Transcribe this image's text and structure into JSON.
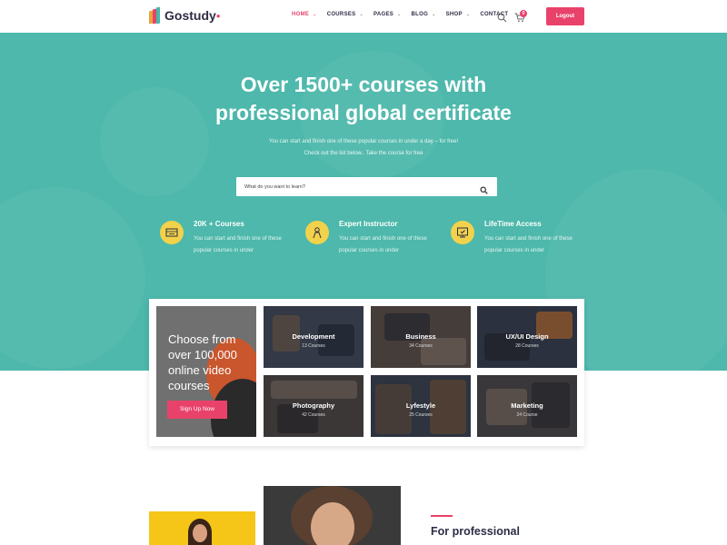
{
  "brand": {
    "name": "Gostudy",
    "colors": {
      "primary": "#e9426a",
      "hero": "#4db8ab",
      "accent": "#f2d24b",
      "dark": "#2c2c45"
    }
  },
  "nav": {
    "items": [
      {
        "label": "HOME",
        "active": true,
        "has_caret": true
      },
      {
        "label": "COURSES",
        "active": false,
        "has_caret": true
      },
      {
        "label": "PAGES",
        "active": false,
        "has_caret": true
      },
      {
        "label": "BLOG",
        "active": false,
        "has_caret": true
      },
      {
        "label": "SHOP",
        "active": false,
        "has_caret": true
      },
      {
        "label": "CONTACT",
        "active": false,
        "has_caret": false
      }
    ],
    "cart_count": "0",
    "logout_label": "Logout",
    "icons": {
      "search": "search-icon",
      "cart": "cart-icon",
      "caret": "chevron-down-icon"
    }
  },
  "hero": {
    "title_line1_pre": "Over ",
    "title_line1_bold": "1500+",
    "title_line1_post": " courses with",
    "title_line2_bold": "professional",
    "title_line2_post": " global certificate",
    "subtitle_line1": "You can start and finish one of these popular courses in under a day – for free!",
    "subtitle_line2": "Check out the list below.. Take the course for free",
    "search_placeholder": "What do you want to learn?",
    "features": [
      {
        "title": "20K + Courses",
        "text": "You can start and finish one of these popular courses in under",
        "icon": "courses-icon"
      },
      {
        "title": "Expert Instructor",
        "text": "You can start and finish one of these popular courses in under",
        "icon": "instructor-icon"
      },
      {
        "title": "LifeTime Access",
        "text": "You can start and finish one of these popular courses in under",
        "icon": "lifetime-access-icon"
      }
    ]
  },
  "promo": {
    "text": "Choose from over 100,000 online video courses",
    "button_label": "Sign Up Now"
  },
  "categories": [
    {
      "name": "Development",
      "count": "13 Courses"
    },
    {
      "name": "Business",
      "count": "34 Courses"
    },
    {
      "name": "UX/UI Design",
      "count": "28 Courses"
    },
    {
      "name": "Photography",
      "count": "42 Courses"
    },
    {
      "name": "Lyfestyle",
      "count": "25 Courses"
    },
    {
      "name": "Marketing",
      "count": "24 Course"
    }
  ],
  "bottom": {
    "heading": "For professional"
  }
}
